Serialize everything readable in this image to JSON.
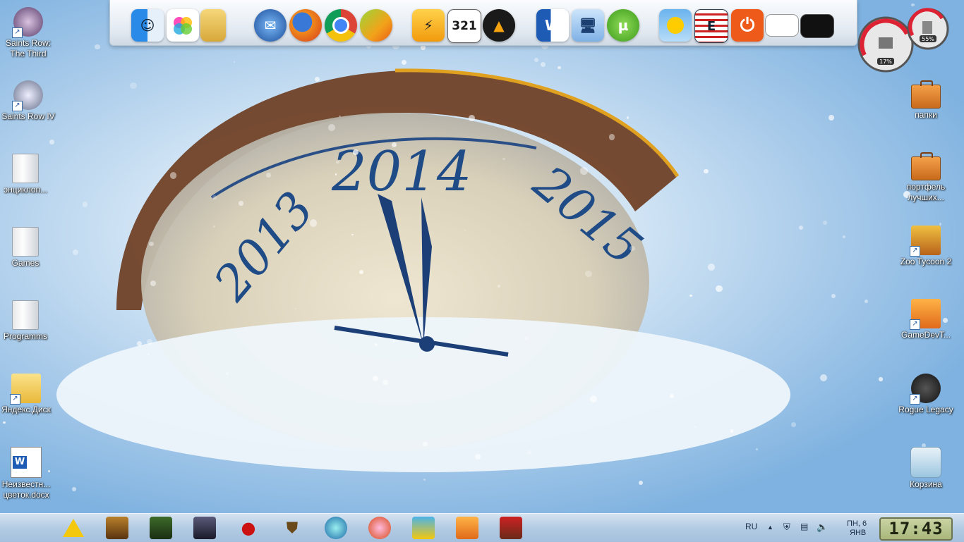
{
  "desktop": {
    "clock_years": {
      "center": "2014",
      "left": "2013",
      "right": "2015"
    },
    "left_icons": [
      {
        "name": "saints-row-the-third",
        "label": "Saints Row: The Third",
        "shortcut": true
      },
      {
        "name": "saints-row-iv",
        "label": "Saints Row IV",
        "shortcut": true
      },
      {
        "name": "enciclopedia",
        "label": "энциклоп...",
        "shortcut": false
      },
      {
        "name": "games",
        "label": "Games",
        "shortcut": false
      },
      {
        "name": "programms",
        "label": "Programms",
        "shortcut": false
      },
      {
        "name": "yandex-disk",
        "label": "Яндекс.Диск",
        "shortcut": true
      },
      {
        "name": "docx",
        "label": "Неизвестн... цветок.docx",
        "shortcut": false
      }
    ],
    "right_icons": [
      {
        "name": "papki",
        "label": "папки",
        "shortcut": false
      },
      {
        "name": "portfel",
        "label": "портфель лучших...",
        "shortcut": false
      },
      {
        "name": "zoo-tycoon-2",
        "label": "Zoo Tycoon 2",
        "shortcut": true
      },
      {
        "name": "gamedev",
        "label": "GameDevT...",
        "shortcut": true
      },
      {
        "name": "rogue-legacy",
        "label": "Rogue Legacy",
        "shortcut": true
      },
      {
        "name": "recycle-bin",
        "label": "Корзина",
        "shortcut": false
      }
    ]
  },
  "dock": {
    "items": [
      "finder",
      "color-picker",
      "folder",
      "thunderbird",
      "firefox",
      "chrome",
      "bluestacks",
      "winamp",
      "media-player-classic",
      "aimp",
      "word",
      "network",
      "utorrent",
      "weather",
      "e-document",
      "power",
      "window-preview-1",
      "window-preview-2"
    ],
    "mpc_label": "321",
    "word_label": "W",
    "e_label": "E"
  },
  "gauges": {
    "cpu": "17%",
    "ram": "55%"
  },
  "taskbar": {
    "apps": [
      "apple-menu",
      "aimp",
      "game-scroll",
      "warcraft-orc",
      "warcraft-undead",
      "red-character",
      "shield",
      "swirl",
      "orange-app",
      "yandex",
      "gamedev",
      "tractor"
    ],
    "language": "RU",
    "date_line1": "ПН, 6",
    "date_line2": "ЯНВ",
    "time": "17:43"
  }
}
